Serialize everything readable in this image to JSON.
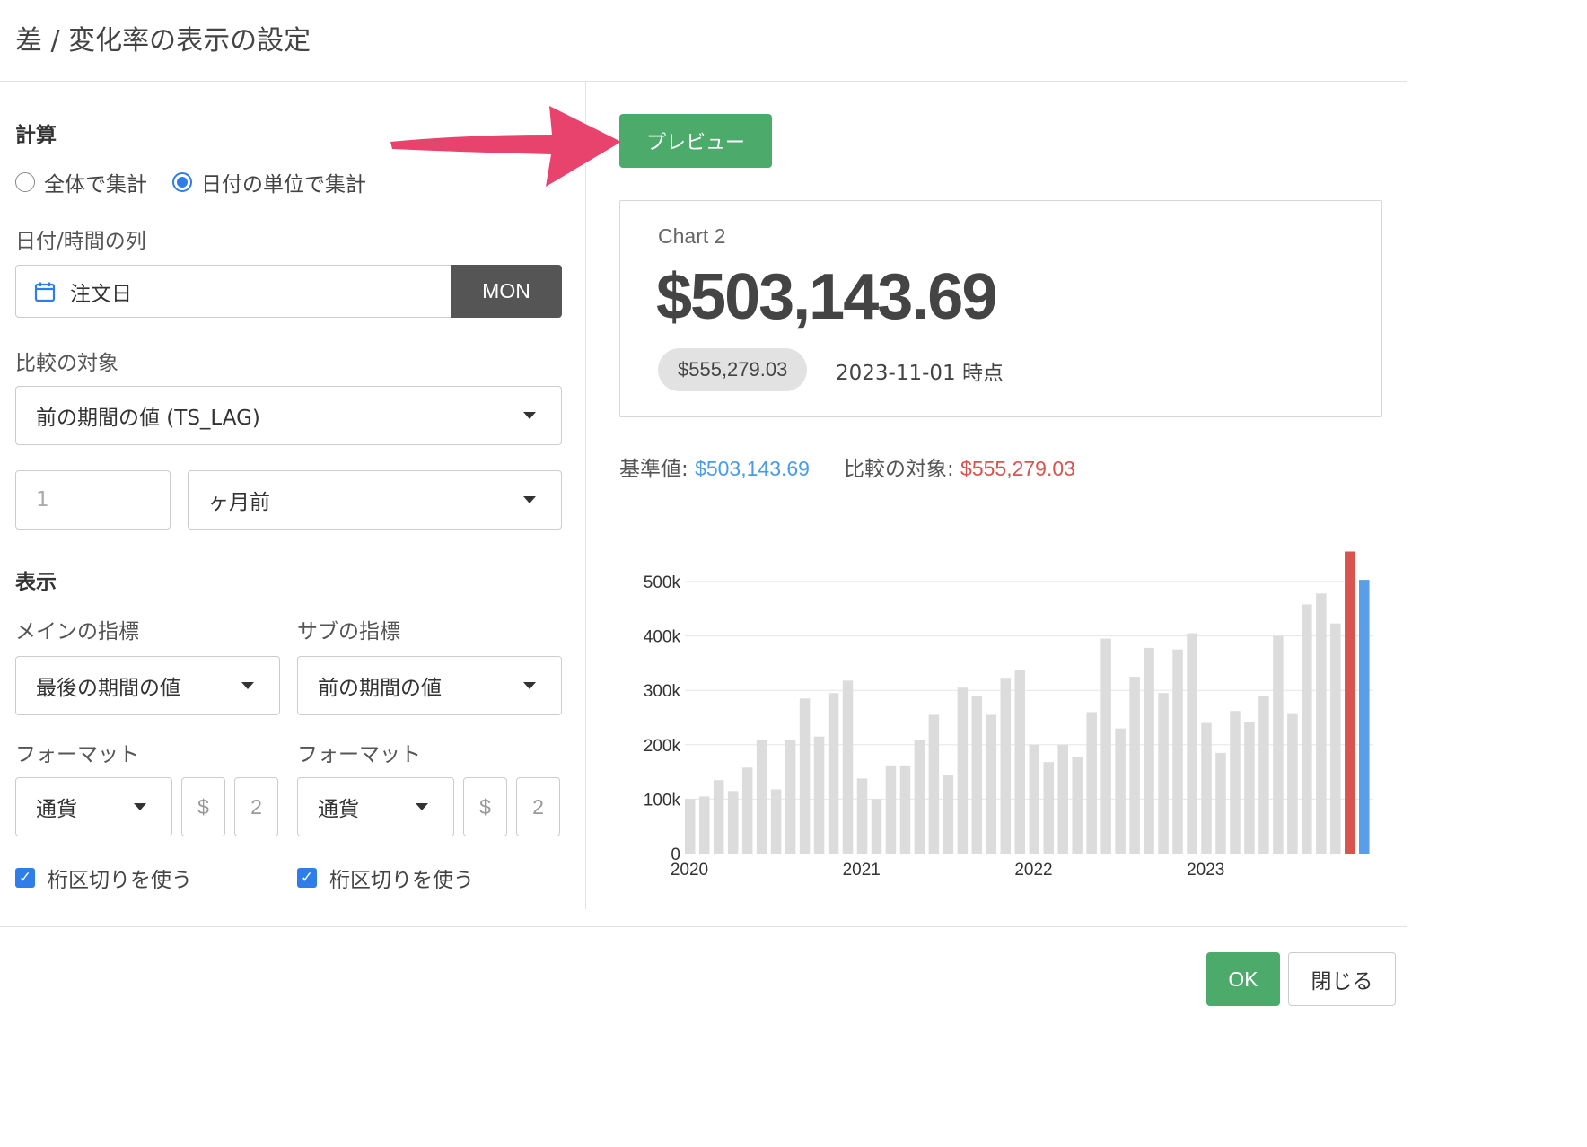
{
  "dialog": {
    "title": "差 / 変化率の表示の設定"
  },
  "calc": {
    "section_title": "計算",
    "radio_all": "全体で集計",
    "radio_date": "日付の単位で集計",
    "date_col_label": "日付/時間の列",
    "date_col_value": "注文日",
    "date_unit": "MON",
    "compare_label": "比較の対象",
    "compare_value": "前の期間の値 (TS_LAG)",
    "lag_placeholder": "1",
    "lag_unit": "ヶ月前"
  },
  "display": {
    "section_title": "表示",
    "main_metric_label": "メインの指標",
    "main_metric_value": "最後の期間の値",
    "sub_metric_label": "サブの指標",
    "sub_metric_value": "前の期間の値",
    "main_format_label": "フォーマット",
    "main_format_value": "通貨",
    "main_symbol": "$",
    "main_decimals": "2",
    "sub_format_label": "フォーマット",
    "sub_format_value": "通貨",
    "sub_symbol": "$",
    "sub_decimals": "2",
    "main_separator": "桁区切りを使う",
    "sub_separator": "桁区切りを使う"
  },
  "preview": {
    "button": "プレビュー",
    "chart_title": "Chart 2",
    "main_value": "$503,143.69",
    "compare_value": "$555,279.03",
    "as_of": "2023-11-01 時点",
    "legend_base_label": "基準値: ",
    "legend_base_value": "$503,143.69",
    "legend_compare_label": "比較の対象: ",
    "legend_compare_value": "$555,279.03"
  },
  "footer": {
    "ok": "OK",
    "close": "閉じる"
  },
  "colors": {
    "accent_green": "#4caa6b",
    "bar_gray": "#dcdcdc",
    "compare_red": "#d9534f",
    "base_blue": "#5a9de8",
    "arrow_pink": "#e8436c"
  },
  "chart_data": {
    "type": "bar",
    "x_tick_labels": [
      "2020",
      "2021",
      "2022",
      "2023"
    ],
    "y_tick_labels": [
      "0",
      "100k",
      "200k",
      "300k",
      "400k",
      "500k"
    ],
    "ylim": [
      0,
      560000
    ],
    "series": [
      {
        "values": [
          100000,
          105000,
          135000,
          115000,
          158000,
          208000,
          118000,
          208000,
          285000,
          215000,
          295000,
          318000,
          138000,
          100000,
          162000,
          162000,
          208000,
          255000,
          145000,
          305000,
          290000,
          255000,
          323000,
          338000,
          200000,
          168000,
          200000,
          178000,
          260000,
          395000,
          230000,
          325000,
          378000,
          295000,
          375000,
          405000,
          240000,
          185000,
          262000,
          242000,
          290000,
          400000,
          258000,
          458000,
          478000,
          423000
        ]
      },
      {
        "values": [
          555279.03
        ]
      },
      {
        "values": [
          503143.69
        ]
      }
    ]
  }
}
